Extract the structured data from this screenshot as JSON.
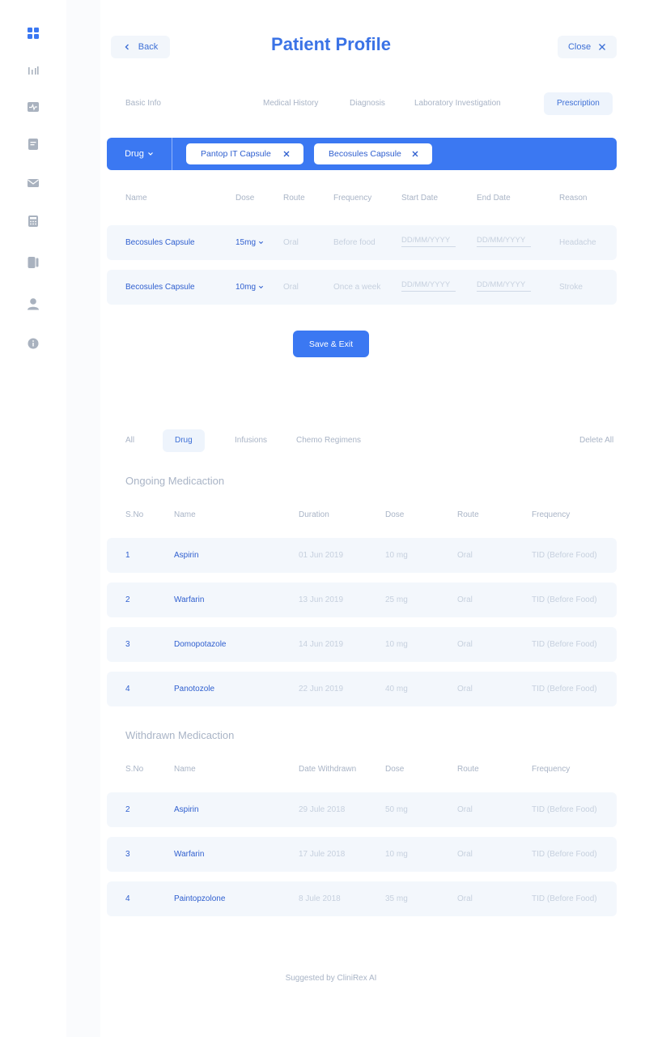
{
  "header": {
    "back_label": "Back",
    "title": "Patient Profile",
    "close_label": "Close"
  },
  "sidebar": {
    "items": [
      {
        "icon": "dashboard-icon",
        "active": true
      },
      {
        "icon": "bar-chart-icon"
      },
      {
        "icon": "vitals-icon"
      },
      {
        "icon": "document-icon"
      },
      {
        "icon": "mail-icon"
      },
      {
        "icon": "calculator-icon"
      },
      {
        "icon": "cards-icon"
      },
      {
        "icon": "user-icon"
      },
      {
        "icon": "info-icon"
      }
    ]
  },
  "profile_tabs": [
    {
      "label": "Basic Info",
      "active": false
    },
    {
      "label": "Medical History",
      "active": false
    },
    {
      "label": "Diagnosis",
      "active": false
    },
    {
      "label": "Laboratory Investigation",
      "active": false
    },
    {
      "label": "Prescription",
      "active": true
    }
  ],
  "drug_bar": {
    "selected": "Drug",
    "chips": [
      "Pantop IT Capsule",
      "Becosules Capsule"
    ]
  },
  "prescription": {
    "columns": [
      "Name",
      "Dose",
      "Route",
      "Frequency",
      "Start Date",
      "End Date",
      "Reason"
    ],
    "date_placeholder": "DD/MM/YYYY",
    "rows": [
      {
        "name": "Becosules Capsule",
        "dose": "15mg",
        "route": "Oral",
        "frequency": "Before food",
        "reason": "Headache"
      },
      {
        "name": "Becosules Capsule",
        "dose": "10mg",
        "route": "Oral",
        "frequency": "Once a week",
        "reason": "Stroke"
      }
    ],
    "save_label": "Save & Exit"
  },
  "filters": {
    "tabs": [
      {
        "label": "All",
        "active": false
      },
      {
        "label": "Drug",
        "active": true
      },
      {
        "label": "Infusions",
        "active": false
      },
      {
        "label": "Chemo Regimens",
        "active": false
      }
    ],
    "delete_all": "Delete All"
  },
  "ongoing": {
    "title": "Ongoing Medicaction",
    "columns": [
      "S.No",
      "Name",
      "Duration",
      "Dose",
      "Route",
      "Frequency"
    ],
    "rows": [
      {
        "sno": "1",
        "name": "Aspirin",
        "duration": "01 Jun 2019",
        "dose": "10 mg",
        "route": "Oral",
        "frequency": "TID (Before Food)"
      },
      {
        "sno": "2",
        "name": "Warfarin",
        "duration": "13 Jun 2019",
        "dose": "25 mg",
        "route": "Oral",
        "frequency": "TID (Before Food)"
      },
      {
        "sno": "3",
        "name": "Domopotazole",
        "duration": "14 Jun 2019",
        "dose": "10 mg",
        "route": "Oral",
        "frequency": "TID (Before Food)"
      },
      {
        "sno": "4",
        "name": "Panotozole",
        "duration": "22 Jun 2019",
        "dose": "40 mg",
        "route": "Oral",
        "frequency": "TID (Before Food)"
      }
    ]
  },
  "withdrawn": {
    "title": "Withdrawn Medicaction",
    "columns": [
      "S.No",
      "Name",
      "Date Withdrawn",
      "Dose",
      "Route",
      "Frequency"
    ],
    "rows": [
      {
        "sno": "2",
        "name": "Aspirin",
        "date": "29 Jule 2018",
        "dose": "50 mg",
        "route": "Oral",
        "frequency": "TID (Before Food)"
      },
      {
        "sno": "3",
        "name": "Warfarin",
        "date": "17 Jule 2018",
        "dose": "10 mg",
        "route": "Oral",
        "frequency": "TID (Before Food)"
      },
      {
        "sno": "4",
        "name": "Paintopzolone",
        "date": "8 Jule 2018",
        "dose": "35 mg",
        "route": "Oral",
        "frequency": "TID (Before Food)"
      }
    ]
  },
  "footer": {
    "note": "Suggested by CliniRex AI"
  },
  "colors": {
    "accent": "#3b78f2",
    "row_bg": "#f3f7fc",
    "muted_text": "#a9b4c6",
    "link_text": "#2f5fcf"
  }
}
